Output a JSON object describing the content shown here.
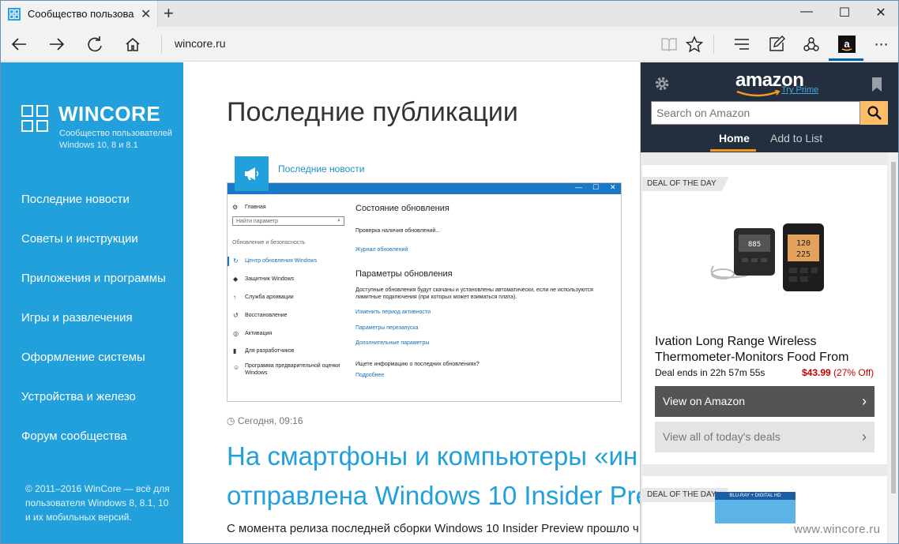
{
  "browser": {
    "tab_title": "Сообщество пользова",
    "url": "wincore.ru"
  },
  "sidebar": {
    "logo_name": "WINCORE",
    "logo_sub_1": "Сообщество пользователей",
    "logo_sub_2": "Windows 10, 8 и 8.1",
    "items": [
      {
        "label": "Последние новости"
      },
      {
        "label": "Советы и инструкции"
      },
      {
        "label": "Приложения и программы"
      },
      {
        "label": "Игры и развлечения"
      },
      {
        "label": "Оформление системы"
      },
      {
        "label": "Устройства и железо"
      },
      {
        "label": "Форум сообщества"
      }
    ],
    "copyright_1": "© 2011–2016 WinCore — всё для",
    "copyright_2": "пользователя Windows 8, 8.1, 10",
    "copyright_3": "и их мобильных версий."
  },
  "main": {
    "page_title": "Последние публикации",
    "category": "Последние новости",
    "settings_shot": {
      "nav": [
        {
          "label": "Главная",
          "icon": "home-icon"
        },
        {
          "label": "Обновление и безопасность",
          "icon": ""
        },
        {
          "label": "Центр обновления Windows",
          "icon": "sync-icon"
        },
        {
          "label": "Защитник Windows",
          "icon": "shield-icon"
        },
        {
          "label": "Служба архивации",
          "icon": "backup-icon"
        },
        {
          "label": "Восстановление",
          "icon": "recovery-icon"
        },
        {
          "label": "Активация",
          "icon": "activation-icon"
        },
        {
          "label": "Для разработчиков",
          "icon": "developer-icon"
        },
        {
          "label": "Программа предварительной оценки",
          "icon": "insider-icon"
        },
        {
          "label": "Windows",
          "icon": ""
        }
      ],
      "search_placeholder": "Найти параметр",
      "status_heading": "Состояние обновления",
      "checking": "Проверка наличия обновлений...",
      "log_link": "Журнал обновлений",
      "params_heading": "Параметры обновления",
      "params_text_1": "Доступные обновления будут скачаны и установлены автоматически, если не используются",
      "params_text_2": "лимитные подключения (при которых может взиматься плата).",
      "link_1": "Изменить период активности",
      "link_2": "Параметры перезапуска",
      "link_3": "Дополнительные параметры",
      "question": "Ищете информацию о последних обновлениях?",
      "more_link": "Подробнее"
    },
    "post_date": "Сегодня, 09:16",
    "post_title_1": "На смартфоны и компьютеры «ин",
    "post_title_2": "отправлена Windows 10 Insider Pre",
    "post_text": "С момента релиза последней сборки Windows 10 Insider Preview прошло ч"
  },
  "amazon": {
    "logo": "amazon",
    "try_prime": "Try Prime",
    "search_placeholder": "Search on Amazon",
    "tabs": {
      "home": "Home",
      "add_to_list": "Add to List"
    },
    "deal_tag": "DEAL OF THE DAY",
    "deal_name": "Ivation Long Range Wireless Thermometer-Monitors Food From",
    "deal_ends": "Deal ends in 22h 57m 55s",
    "deal_price": "$43.99",
    "deal_discount": "(27% Off)",
    "view_button": "View on Amazon",
    "all_deals_button": "View all of today's deals",
    "deal_tag_2": "DEAL OF THE DAY",
    "bluray_label": "BLU-RAY + DIGITAL HD"
  },
  "watermark": "www.wincore.ru",
  "colors": {
    "sidebar_blue": "#21a0db",
    "amazon_dark": "#232f3e",
    "amazon_orange": "#febd69",
    "price_red": "#c40000"
  }
}
